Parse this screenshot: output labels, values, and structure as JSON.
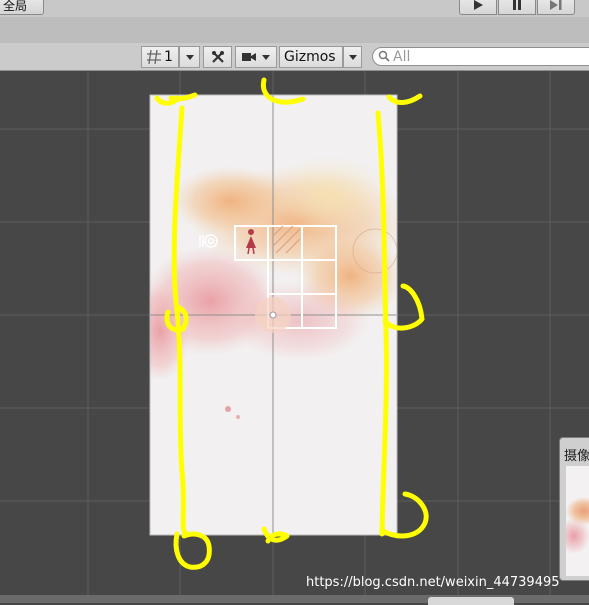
{
  "layout_button": {
    "label": "全局"
  },
  "play_controls": {
    "play_icon": "play-icon",
    "pause_icon": "pause-icon",
    "step_icon": "step-icon"
  },
  "scene_toolbar": {
    "grid_value": "1",
    "gizmos_label": "Gizmos",
    "search_placeholder": "All"
  },
  "camera_preview": {
    "title": "摄像机"
  },
  "watermark": "https://blog.csdn.net/weixin_44739495",
  "colors": {
    "annotation": "#ffff00",
    "scene_background": "#474747",
    "canvas": "#f2f0f0"
  }
}
